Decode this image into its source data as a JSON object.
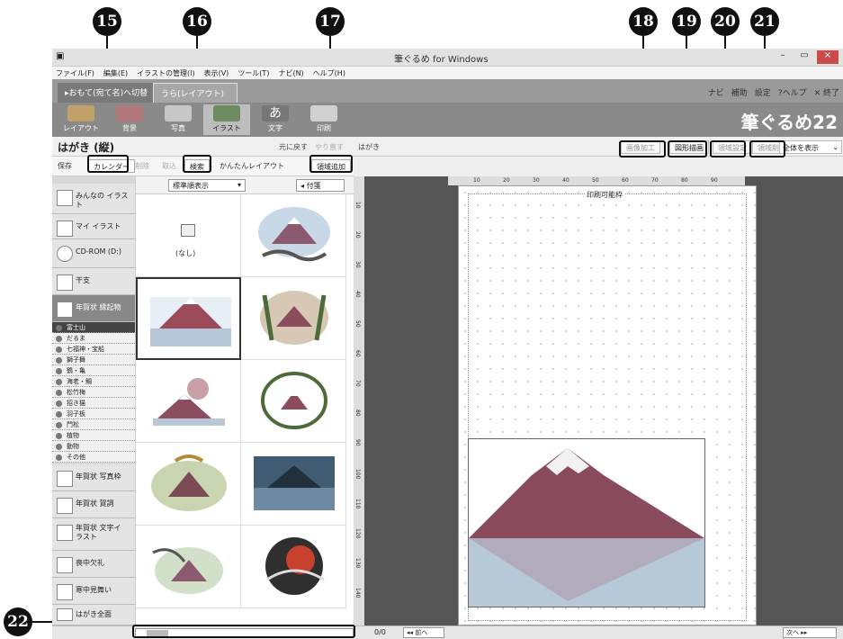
{
  "window": {
    "title": "筆ぐるめ for Windows",
    "controls": [
      "–",
      "▭",
      "×"
    ]
  },
  "menu": [
    "ファイル(F)",
    "編集(E)",
    "イラストの管理(I)",
    "表示(V)",
    "ツール(T)",
    "ナビ(N)",
    "ヘルプ(H)"
  ],
  "modes": {
    "front": "▸おもて(宛て名)へ切替",
    "back": "うら(レイアウト)"
  },
  "rightlinks": [
    "ナビ",
    "補助",
    "設定",
    "?ヘルプ",
    "✕ 終了"
  ],
  "tools": [
    "レイアウト",
    "背景",
    "写真",
    "イラスト",
    "文字",
    "印刷"
  ],
  "brand": "筆ぐるめ22",
  "header": {
    "title": "はがき (縦)",
    "undo": "元に戻す",
    "redo": "やり直す",
    "canvas_label": "はがき",
    "image_edit": "画像加工",
    "shape_draw": "図形描画",
    "area_settings": "領域設定",
    "area_delete": "領域削除",
    "view": "全体を表示"
  },
  "toolbar2": {
    "save": "保存",
    "calendar": "カレンダー",
    "delete": "削除",
    "cancel": "取込",
    "search": "検索",
    "easy_layout": "かんたんレイアウト",
    "add_area": "領域追加"
  },
  "categories": [
    "みんなの イラスト",
    "マイ イラスト",
    "CD-ROM (D:)",
    "干支",
    "年賀状 縁起物",
    "年賀状 写真枠",
    "年賀状 賀詞",
    "年賀状 文字イラスト",
    "喪中欠礼",
    "寒中見舞い",
    "はがき全面"
  ],
  "subcategories": [
    "富士山",
    "だるま",
    "七福神・宝船",
    "獅子舞",
    "鶴・亀",
    "海老・鯛",
    "松竹梅",
    "招き猫",
    "羽子板",
    "門松",
    "植物",
    "動物",
    "その他"
  ],
  "grid": {
    "sort": "標準順表示",
    "tag": "付箋",
    "none_label": "(なし)"
  },
  "canvas": {
    "printable_label": "印刷可能枠",
    "ruler": [
      "10",
      "20",
      "30",
      "40",
      "50",
      "60",
      "70",
      "80",
      "90"
    ],
    "ruler_v": [
      "10",
      "20",
      "30",
      "40",
      "50",
      "60",
      "70",
      "80",
      "90",
      "100",
      "110",
      "120",
      "130",
      "140"
    ]
  },
  "bottom": {
    "page": "0/0",
    "prev": "前へ",
    "next": "次へ"
  },
  "callouts": [
    "15",
    "16",
    "17",
    "18",
    "19",
    "20",
    "21",
    "22"
  ],
  "colors": {
    "accent": "#111111",
    "toolbar": "#8a8a8a",
    "canvas_bg": "#555555"
  }
}
